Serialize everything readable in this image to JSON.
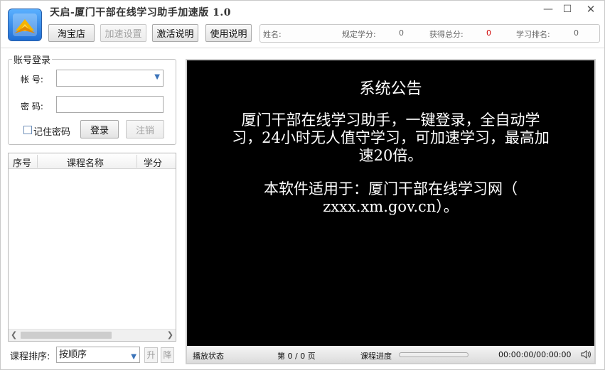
{
  "window": {
    "title": "天启-厦门干部在线学习助手加速版 1.0",
    "controls": {
      "minimize": "—",
      "maximize": "☐",
      "close": "✕"
    }
  },
  "toolbar": {
    "taobao": "淘宝店",
    "speed_settings": "加速设置",
    "activation_help": "激活说明",
    "usage_help": "使用说明"
  },
  "info_bar": {
    "name_label": "姓名:",
    "name_value": "",
    "required_credits_label": "规定学分:",
    "required_credits_value": "0",
    "total_score_label": "获得总分:",
    "total_score_value": "0",
    "rank_label": "学习排名:",
    "rank_value": "0"
  },
  "login": {
    "group_title": "账号登录",
    "account_label": "帐  号:",
    "account_value": "",
    "password_label": "密  码:",
    "password_value": "",
    "remember_label": "记住密码",
    "remember_checked": false,
    "login_button": "登录",
    "logout_button": "注销"
  },
  "course_table": {
    "columns": [
      "序号",
      "课程名称",
      "学分"
    ],
    "rows": []
  },
  "sort": {
    "label": "课程排序:",
    "selected": "按顺序",
    "up_button": "升",
    "down_button": "降"
  },
  "announcement": {
    "title": "系统公告",
    "line1a": "厦门干部在线学习助手，一键登录，全自动学",
    "line1b": "习，24小时无人值守学习，可加速学习，最高加",
    "line1c": "速20倍。",
    "line2a": "本软件适用于：厦门干部在线学习网（",
    "line2b": "zxxx.xm.gov.cn）。"
  },
  "player": {
    "status_label": "播放状态",
    "status_value": "",
    "page_text": "第 0 / 0 页",
    "progress_label": "课程进度",
    "progress_fraction": 0,
    "time_text": "00:00:00/00:00:00"
  },
  "colors": {
    "accent_blue": "#3b73b9",
    "score_red": "#d00000",
    "screen_bg": "#000000"
  },
  "icons": {
    "logo": "app-logo-icon",
    "combo": "chevron-down-icon",
    "speaker": "speaker-icon"
  }
}
